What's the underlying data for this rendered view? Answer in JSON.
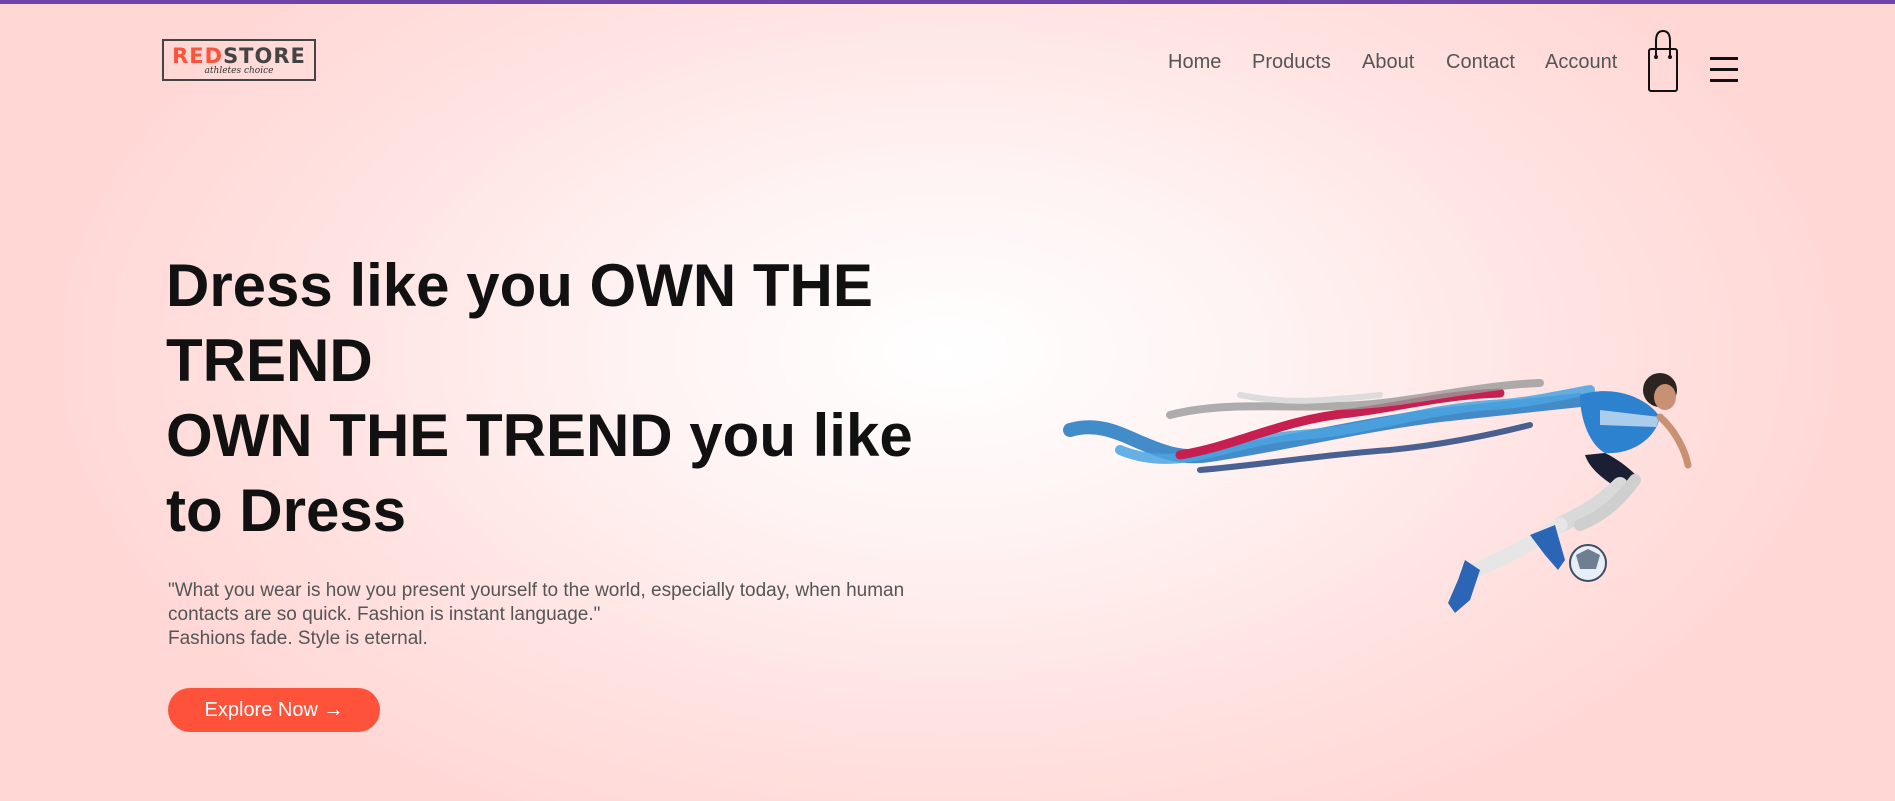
{
  "colors": {
    "accent": "#ff523b",
    "top_strip": "#6e44a8",
    "heading": "#111111",
    "body_text": "#555555"
  },
  "header": {
    "logo": {
      "brand_red": "RED",
      "brand_dark": "STORE",
      "tagline": "athletes choice"
    },
    "nav": [
      {
        "label": "Home"
      },
      {
        "label": "Products"
      },
      {
        "label": "About"
      },
      {
        "label": "Contact"
      },
      {
        "label": "Account"
      }
    ],
    "cart_icon": "shopping-bag-icon",
    "menu_icon": "hamburger-menu-icon"
  },
  "hero": {
    "title_lines": [
      "Dress like you OWN THE",
      "TREND",
      "OWN THE TREND you like",
      "to Dress"
    ],
    "quote_lines": [
      "\"What you wear is how you present yourself to the world, especially today, when human",
      "contacts are so quick. Fashion is instant language.\"",
      "Fashions fade. Style is eternal."
    ],
    "cta_label": "Explore Now →",
    "image_subject": "footballer-with-ribbons-image"
  }
}
